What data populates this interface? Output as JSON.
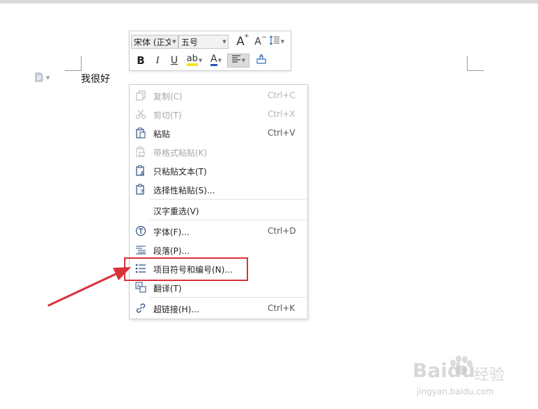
{
  "document": {
    "text": "我很好"
  },
  "mini_toolbar": {
    "font_name": "宋体 (正文",
    "font_size": "五号",
    "grow_font_glyph": "A",
    "shrink_font_glyph": "A",
    "bold_glyph": "B",
    "italic_glyph": "I",
    "underline_glyph": "U",
    "highlight_glyph": "ab",
    "font_color_glyph": "A"
  },
  "context_menu": {
    "items": [
      {
        "label": "复制(C)",
        "shortcut": "Ctrl+C",
        "enabled": false
      },
      {
        "label": "剪切(T)",
        "shortcut": "Ctrl+X",
        "enabled": false
      },
      {
        "label": "粘贴",
        "shortcut": "Ctrl+V",
        "enabled": true
      },
      {
        "label": "带格式粘贴(K)",
        "shortcut": "",
        "enabled": false
      },
      {
        "label": "只粘贴文本(T)",
        "shortcut": "",
        "enabled": true
      },
      {
        "label": "选择性粘贴(S)...",
        "shortcut": "",
        "enabled": true
      },
      {
        "label": "汉字重选(V)",
        "shortcut": "",
        "enabled": true
      },
      {
        "label": "字体(F)...",
        "shortcut": "Ctrl+D",
        "enabled": true
      },
      {
        "label": "段落(P)...",
        "shortcut": "",
        "enabled": true
      },
      {
        "label": "项目符号和编号(N)...",
        "shortcut": "",
        "enabled": true
      },
      {
        "label": "翻译(T)",
        "shortcut": "",
        "enabled": true
      },
      {
        "label": "超链接(H)...",
        "shortcut": "Ctrl+K",
        "enabled": true
      }
    ]
  },
  "annotation": {
    "highlight_color": "#d9313a"
  },
  "watermark": {
    "brand": "Baidu",
    "brand_cn": "经验",
    "url": "jingyan.baidu.com"
  }
}
